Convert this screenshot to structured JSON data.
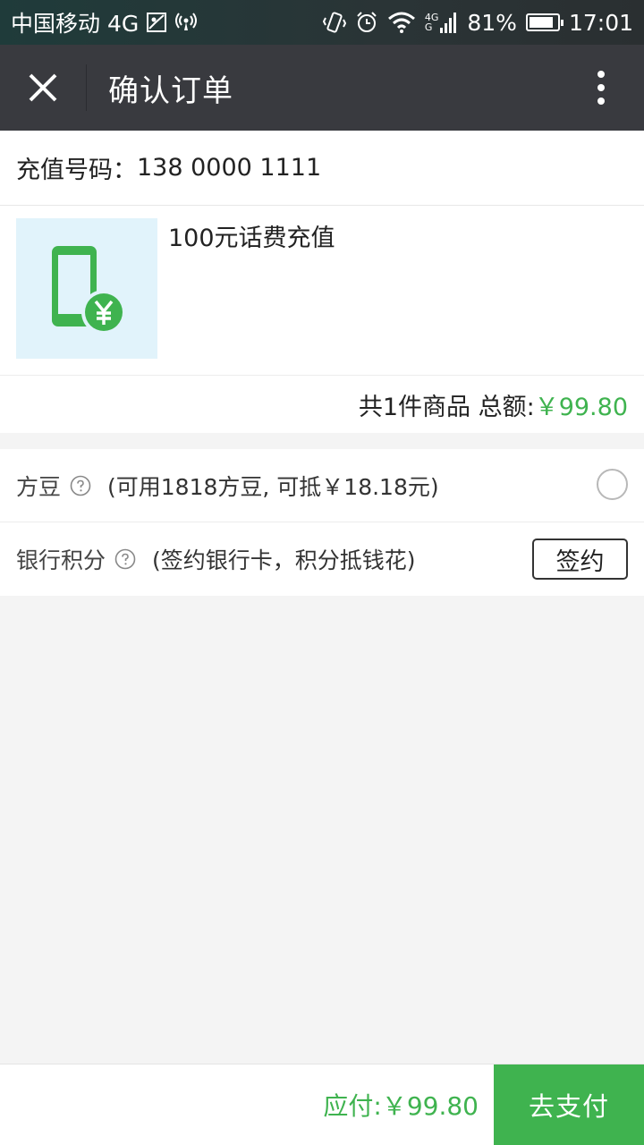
{
  "status_bar": {
    "carrier": "中国移动 4G",
    "battery": "81%",
    "time": "17:01",
    "signal_badge_top": "4G",
    "signal_badge_bottom": "G"
  },
  "nav": {
    "title": "确认订单"
  },
  "order": {
    "phone_label": "充值号码：",
    "phone_number": "138 0000 1111",
    "product_name": "100元话费充值",
    "summary_prefix": "共1件商品 总额:",
    "summary_total": "￥99.80"
  },
  "discounts": {
    "beans_label": "方豆",
    "beans_desc": "(可用1818方豆, 可抵￥18.18元)",
    "bank_label": "银行积分",
    "bank_desc": "(签约银行卡，积分抵钱花)",
    "sign_button": "签约"
  },
  "footer": {
    "payable_text": "应付:￥99.80",
    "pay_button": "去支付"
  },
  "colors": {
    "accent_green": "#3fb34f",
    "nav_bg": "#393a3f",
    "thumb_bg": "#e1f3fb"
  },
  "icons": {
    "close": "close-icon",
    "more": "more-vertical-icon",
    "help": "help-circle-icon",
    "product": "phone-yuan-icon"
  }
}
